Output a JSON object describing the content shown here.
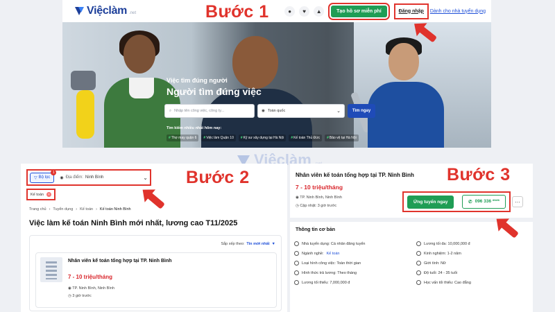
{
  "step_labels": {
    "step1": "Bước 1",
    "step2": "Bước 2",
    "step3": "Bước 3"
  },
  "colors": {
    "brand": "#1d3f9a",
    "accent_green": "#1f9d55",
    "highlight_red": "#e0332c",
    "salary_red": "#d9262c",
    "link_blue": "#1d4ed8"
  },
  "header": {
    "logo_text": "Việclàm",
    "logo_tld": ".net",
    "icons": [
      "chat-icon",
      "heart-icon",
      "bell-icon"
    ],
    "create_cv_label": "Tạo hồ sơ miễn phí",
    "login_label": "Đăng nhập",
    "employer_label": "Dành cho nhà tuyển dụng"
  },
  "hero": {
    "subtitle": "Việc tìm đúng người",
    "title": "Người tìm đúng việc",
    "search_placeholder": "Nhập tên công việc, công ty...",
    "location_value": "Toàn quốc",
    "search_button": "Tìm ngay",
    "popular_title": "Tìm kiếm nhiều nhất hôm nay:",
    "popular_tags": [
      "Thợ may quận 6",
      "Việc làm Quận 10",
      "Kỹ sư xây dựng tại Hà Nội",
      "Kế toán Thủ Đức",
      "Bảo vệ tại Hà Nội"
    ]
  },
  "watermark": {
    "name": "Việclàm",
    "tld": ".net"
  },
  "step2": {
    "filter_label": "Bộ lọc",
    "filter_badge": "1",
    "location_label": "Địa điểm:",
    "location_value": "Ninh Bình",
    "chip_label": "Kế toán",
    "breadcrumb": [
      "Trang chủ",
      "Tuyển dụng",
      "Kế toán",
      "Kế toán Ninh Bình"
    ],
    "page_title": "Việc làm kế toán Ninh Bình mới nhất, lương cao T11/2025",
    "sort_label": "Sắp xếp theo:",
    "sort_value": "Tin mới nhất",
    "job": {
      "title": "Nhân viên kế toán tổng hợp tại TP. Ninh Bình",
      "salary": "7 - 10 triệu/tháng",
      "location": "TP. Ninh Bình, Ninh Bình",
      "posted": "3 giờ trước"
    }
  },
  "step3": {
    "title": "Nhân viên kế toán tổng hợp tại TP. Ninh Bình",
    "salary": "7 - 10 triệu/tháng",
    "location": "TP. Ninh Bình, Ninh Bình",
    "updated": "Cập nhật: 3 giờ trước",
    "apply_label": "Ứng tuyển ngay",
    "phone_label": "096 336 ****",
    "more_label": "···",
    "info_title": "Thông tin cơ bản",
    "info_left": [
      {
        "label": "Nhà tuyển dụng: Cá nhân đăng tuyển"
      },
      {
        "label": "Ngành nghề:",
        "link": "Kế toán"
      },
      {
        "label": "Loại hình công việc: Toàn thời gian"
      },
      {
        "label": "Hình thức trả lương: Theo tháng"
      },
      {
        "label": "Lương tối thiểu: 7,000,000 đ"
      }
    ],
    "info_right": [
      {
        "label": "Lương tối đa: 10,000,000 đ"
      },
      {
        "label": "Kinh nghiệm: 1-2 năm"
      },
      {
        "label": "Giới tính: Nữ"
      },
      {
        "label": "Độ tuổi: 24 - 35 tuổi"
      },
      {
        "label": "Học vấn tối thiểu: Cao đẳng"
      }
    ]
  }
}
